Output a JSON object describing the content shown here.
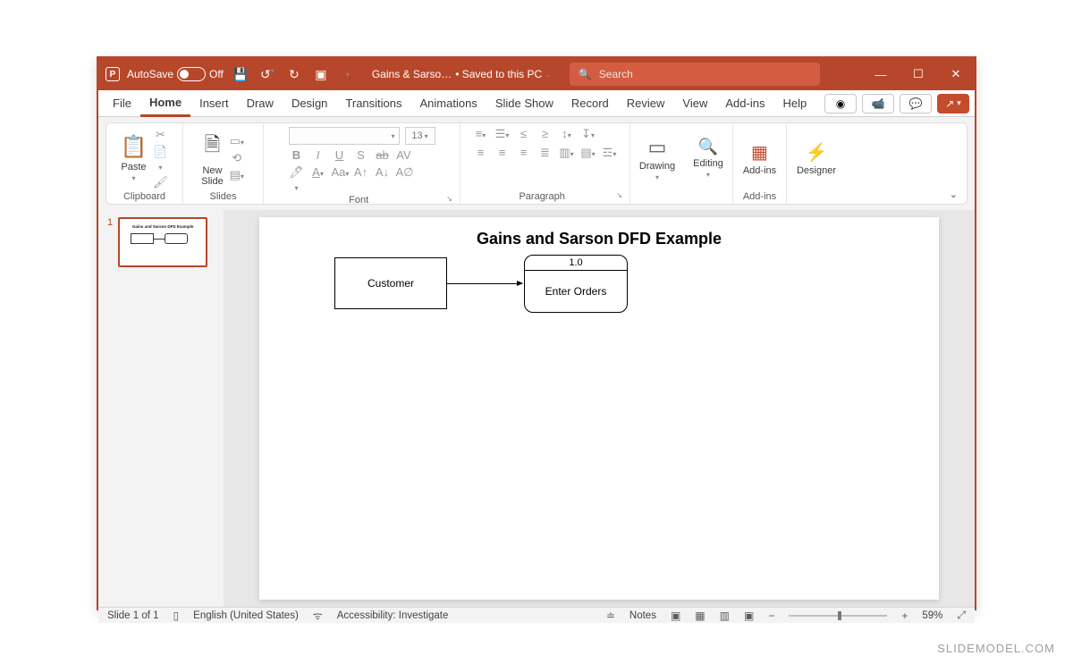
{
  "title": {
    "app": "P",
    "autosave_label": "AutoSave",
    "autosave_state": "Off",
    "doc_name": "Gains & Sarso…",
    "saved_label": "• Saved to this PC",
    "search_placeholder": "Search"
  },
  "window_btns": {
    "min": "—",
    "max": "☐",
    "close": "✕"
  },
  "tabs": {
    "items": [
      "File",
      "Home",
      "Insert",
      "Draw",
      "Design",
      "Transitions",
      "Animations",
      "Slide Show",
      "Record",
      "Review",
      "View",
      "Add-ins",
      "Help"
    ],
    "active": "Home"
  },
  "ribbon": {
    "clipboard": {
      "paste": "Paste",
      "label": "Clipboard"
    },
    "slides": {
      "newslide": "New\nSlide",
      "label": "Slides"
    },
    "font": {
      "size": "13",
      "label": "Font",
      "row1": [
        "B",
        "I",
        "U",
        "S",
        "ab",
        "AV"
      ],
      "row2": [
        "A",
        "A",
        "Aa",
        "A",
        "A",
        "Aା"
      ]
    },
    "paragraph": {
      "label": "Paragraph"
    },
    "drawing": {
      "label": "Drawing",
      "btn": "Drawing"
    },
    "editing": {
      "label": "",
      "btn": "Editing"
    },
    "addins": {
      "label": "Add-ins",
      "btn": "Add-ins"
    },
    "designer": {
      "btn": "Designer"
    }
  },
  "thumbnails": {
    "first_index": "1"
  },
  "slide": {
    "title": "Gains and Sarson DFD Example",
    "entity": "Customer",
    "process_id": "1.0",
    "process_name": "Enter Orders"
  },
  "status": {
    "slide": "Slide 1 of 1",
    "lang": "English (United States)",
    "access": "Accessibility: Investigate",
    "notes": "Notes",
    "zoom": "59%"
  },
  "watermark": "SLIDEMODEL.COM"
}
